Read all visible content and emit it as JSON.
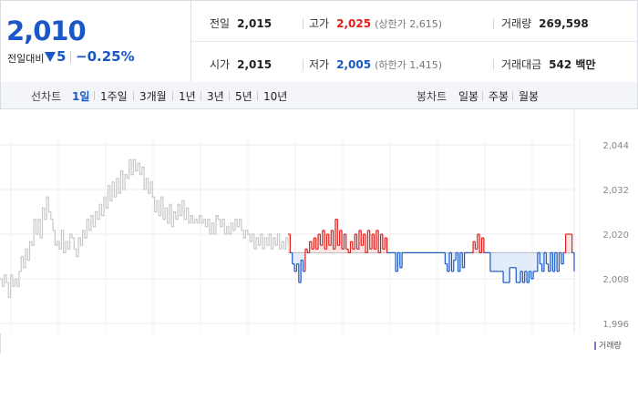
{
  "quote": {
    "price": "2,010",
    "change_label": "전일대비",
    "change_value": "5",
    "change_pct": "−0.25%"
  },
  "stats": {
    "prev_close": {
      "label": "전일",
      "value": "2,015"
    },
    "high": {
      "label": "고가",
      "value": "2,025",
      "sub": "(상한가 2,615)"
    },
    "volume": {
      "label": "거래량",
      "value": "269,598"
    },
    "open": {
      "label": "시가",
      "value": "2,015"
    },
    "low": {
      "label": "저가",
      "value": "2,005",
      "sub": "(하한가 1,415)"
    },
    "trade_amount": {
      "label": "거래대금",
      "value": "542 백만"
    }
  },
  "line_tabs": {
    "label": "선차트",
    "items": [
      "1일",
      "1주일",
      "3개월",
      "1년",
      "3년",
      "5년",
      "10년"
    ],
    "active": 0
  },
  "candle_tabs": {
    "label": "봉차트",
    "items": [
      "일봉",
      "주봉",
      "월봉"
    ]
  },
  "colors": {
    "up": "#e0201c",
    "down": "#1a57c7",
    "prev": "#c9c9c9",
    "baseline": "#7e8594"
  },
  "legend": {
    "volume": "거래량"
  },
  "chart_data": {
    "type": "line",
    "title": "",
    "xlabel": "",
    "ylabel": "",
    "ylim": [
      1994,
      2046
    ],
    "yticks": [
      "2,044",
      "2,032",
      "2,020",
      "2,008",
      "1,996"
    ],
    "ytick_values": [
      2044,
      2032,
      2020,
      2008,
      1996
    ],
    "grid": true,
    "baseline": 2015,
    "previous_session": [
      2008,
      2006,
      2009,
      2007,
      2003,
      2009,
      2006,
      2008,
      2006,
      2010,
      2014,
      2011,
      2016,
      2013,
      2018,
      2017,
      2024,
      2020,
      2024,
      2019,
      2027,
      2024,
      2030,
      2026,
      2024,
      2021,
      2017,
      2018,
      2016,
      2021,
      2015,
      2018,
      2016,
      2020,
      2019,
      2016,
      2014,
      2019,
      2017,
      2021,
      2019,
      2024,
      2021,
      2025,
      2022,
      2026,
      2024,
      2028,
      2025,
      2030,
      2027,
      2033,
      2029,
      2034,
      2030,
      2035,
      2031,
      2037,
      2032,
      2036,
      2035,
      2040,
      2036,
      2040,
      2037,
      2039,
      2036,
      2038,
      2032,
      2035,
      2031,
      2034,
      2030,
      2026,
      2029,
      2025,
      2030,
      2024,
      2027,
      2023,
      2028,
      2022,
      2026,
      2024,
      2028,
      2025,
      2029,
      2024,
      2027,
      2023,
      2025,
      2023,
      2024,
      2023,
      2025,
      2023,
      2024,
      2022,
      2024,
      2020,
      2023,
      2020,
      2025,
      2024,
      2022,
      2024,
      2020,
      2022,
      2020,
      2023,
      2021,
      2024,
      2022,
      2024,
      2021,
      2019,
      2021,
      2020,
      2018,
      2020,
      2016,
      2019,
      2017,
      2020,
      2016,
      2019,
      2017,
      2020,
      2016,
      2019,
      2017,
      2020,
      2016,
      2018,
      2016,
      2019,
      2017
    ],
    "today": [
      2020,
      2015,
      2012,
      2010,
      2012,
      2007,
      2013,
      2010,
      2016,
      2015,
      2018,
      2016,
      2019,
      2016,
      2020,
      2017,
      2021,
      2016,
      2020,
      2017,
      2021,
      2016,
      2024,
      2017,
      2021,
      2016,
      2020,
      2016,
      2015,
      2018,
      2016,
      2020,
      2016,
      2021,
      2017,
      2020,
      2015,
      2021,
      2016,
      2020,
      2016,
      2021,
      2015,
      2020,
      2016,
      2019,
      2015,
      2015,
      2015,
      2015,
      2010,
      2015,
      2011,
      2015,
      2015,
      2015,
      2015,
      2015,
      2015,
      2015,
      2015,
      2015,
      2015,
      2015,
      2015,
      2015,
      2015,
      2015,
      2015,
      2015,
      2015,
      2015,
      2015,
      2012,
      2010,
      2015,
      2010,
      2013,
      2015,
      2010,
      2015,
      2011,
      2015,
      2015,
      2015,
      2015,
      2018,
      2016,
      2020,
      2015,
      2019,
      2015,
      2015,
      2015,
      2010,
      2010,
      2010,
      2010,
      2010,
      2010,
      2007,
      2007,
      2007,
      2011,
      2011,
      2011,
      2007,
      2007,
      2010,
      2007,
      2010,
      2007,
      2010,
      2008,
      2010,
      2010,
      2015,
      2012,
      2010,
      2015,
      2012,
      2010,
      2015,
      2010,
      2015,
      2010,
      2015,
      2012,
      2015,
      2020,
      2020,
      2020,
      2015,
      2010
    ]
  }
}
